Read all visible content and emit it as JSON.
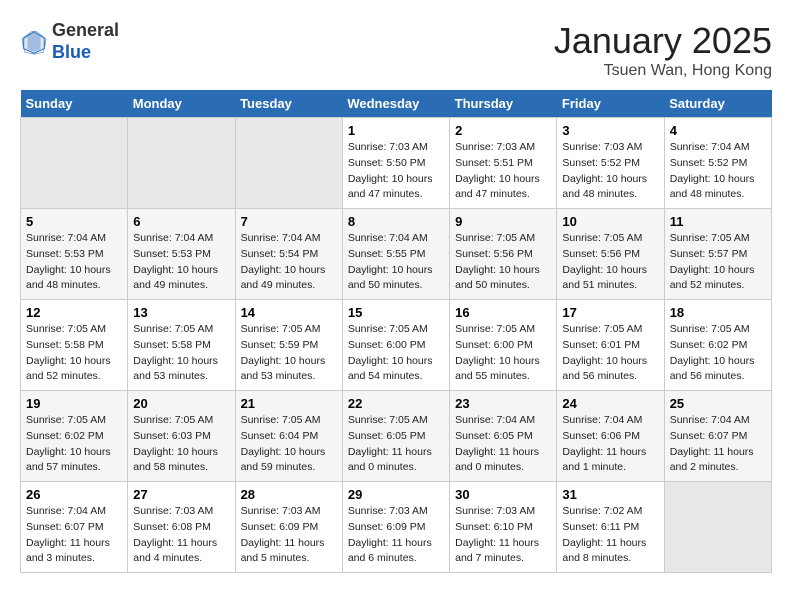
{
  "header": {
    "logo_general": "General",
    "logo_blue": "Blue",
    "month_title": "January 2025",
    "location": "Tsuen Wan, Hong Kong"
  },
  "days_of_week": [
    "Sunday",
    "Monday",
    "Tuesday",
    "Wednesday",
    "Thursday",
    "Friday",
    "Saturday"
  ],
  "weeks": [
    {
      "days": [
        {
          "num": "",
          "empty": true
        },
        {
          "num": "",
          "empty": true
        },
        {
          "num": "",
          "empty": true
        },
        {
          "num": "1",
          "sunrise": "7:03 AM",
          "sunset": "5:50 PM",
          "daylight": "10 hours and 47 minutes."
        },
        {
          "num": "2",
          "sunrise": "7:03 AM",
          "sunset": "5:51 PM",
          "daylight": "10 hours and 47 minutes."
        },
        {
          "num": "3",
          "sunrise": "7:03 AM",
          "sunset": "5:52 PM",
          "daylight": "10 hours and 48 minutes."
        },
        {
          "num": "4",
          "sunrise": "7:04 AM",
          "sunset": "5:52 PM",
          "daylight": "10 hours and 48 minutes."
        }
      ]
    },
    {
      "days": [
        {
          "num": "5",
          "sunrise": "7:04 AM",
          "sunset": "5:53 PM",
          "daylight": "10 hours and 48 minutes."
        },
        {
          "num": "6",
          "sunrise": "7:04 AM",
          "sunset": "5:53 PM",
          "daylight": "10 hours and 49 minutes."
        },
        {
          "num": "7",
          "sunrise": "7:04 AM",
          "sunset": "5:54 PM",
          "daylight": "10 hours and 49 minutes."
        },
        {
          "num": "8",
          "sunrise": "7:04 AM",
          "sunset": "5:55 PM",
          "daylight": "10 hours and 50 minutes."
        },
        {
          "num": "9",
          "sunrise": "7:05 AM",
          "sunset": "5:56 PM",
          "daylight": "10 hours and 50 minutes."
        },
        {
          "num": "10",
          "sunrise": "7:05 AM",
          "sunset": "5:56 PM",
          "daylight": "10 hours and 51 minutes."
        },
        {
          "num": "11",
          "sunrise": "7:05 AM",
          "sunset": "5:57 PM",
          "daylight": "10 hours and 52 minutes."
        }
      ]
    },
    {
      "days": [
        {
          "num": "12",
          "sunrise": "7:05 AM",
          "sunset": "5:58 PM",
          "daylight": "10 hours and 52 minutes."
        },
        {
          "num": "13",
          "sunrise": "7:05 AM",
          "sunset": "5:58 PM",
          "daylight": "10 hours and 53 minutes."
        },
        {
          "num": "14",
          "sunrise": "7:05 AM",
          "sunset": "5:59 PM",
          "daylight": "10 hours and 53 minutes."
        },
        {
          "num": "15",
          "sunrise": "7:05 AM",
          "sunset": "6:00 PM",
          "daylight": "10 hours and 54 minutes."
        },
        {
          "num": "16",
          "sunrise": "7:05 AM",
          "sunset": "6:00 PM",
          "daylight": "10 hours and 55 minutes."
        },
        {
          "num": "17",
          "sunrise": "7:05 AM",
          "sunset": "6:01 PM",
          "daylight": "10 hours and 56 minutes."
        },
        {
          "num": "18",
          "sunrise": "7:05 AM",
          "sunset": "6:02 PM",
          "daylight": "10 hours and 56 minutes."
        }
      ]
    },
    {
      "days": [
        {
          "num": "19",
          "sunrise": "7:05 AM",
          "sunset": "6:02 PM",
          "daylight": "10 hours and 57 minutes."
        },
        {
          "num": "20",
          "sunrise": "7:05 AM",
          "sunset": "6:03 PM",
          "daylight": "10 hours and 58 minutes."
        },
        {
          "num": "21",
          "sunrise": "7:05 AM",
          "sunset": "6:04 PM",
          "daylight": "10 hours and 59 minutes."
        },
        {
          "num": "22",
          "sunrise": "7:05 AM",
          "sunset": "6:05 PM",
          "daylight": "11 hours and 0 minutes."
        },
        {
          "num": "23",
          "sunrise": "7:04 AM",
          "sunset": "6:05 PM",
          "daylight": "11 hours and 0 minutes."
        },
        {
          "num": "24",
          "sunrise": "7:04 AM",
          "sunset": "6:06 PM",
          "daylight": "11 hours and 1 minute."
        },
        {
          "num": "25",
          "sunrise": "7:04 AM",
          "sunset": "6:07 PM",
          "daylight": "11 hours and 2 minutes."
        }
      ]
    },
    {
      "days": [
        {
          "num": "26",
          "sunrise": "7:04 AM",
          "sunset": "6:07 PM",
          "daylight": "11 hours and 3 minutes."
        },
        {
          "num": "27",
          "sunrise": "7:03 AM",
          "sunset": "6:08 PM",
          "daylight": "11 hours and 4 minutes."
        },
        {
          "num": "28",
          "sunrise": "7:03 AM",
          "sunset": "6:09 PM",
          "daylight": "11 hours and 5 minutes."
        },
        {
          "num": "29",
          "sunrise": "7:03 AM",
          "sunset": "6:09 PM",
          "daylight": "11 hours and 6 minutes."
        },
        {
          "num": "30",
          "sunrise": "7:03 AM",
          "sunset": "6:10 PM",
          "daylight": "11 hours and 7 minutes."
        },
        {
          "num": "31",
          "sunrise": "7:02 AM",
          "sunset": "6:11 PM",
          "daylight": "11 hours and 8 minutes."
        },
        {
          "num": "",
          "empty": true
        }
      ]
    }
  ]
}
